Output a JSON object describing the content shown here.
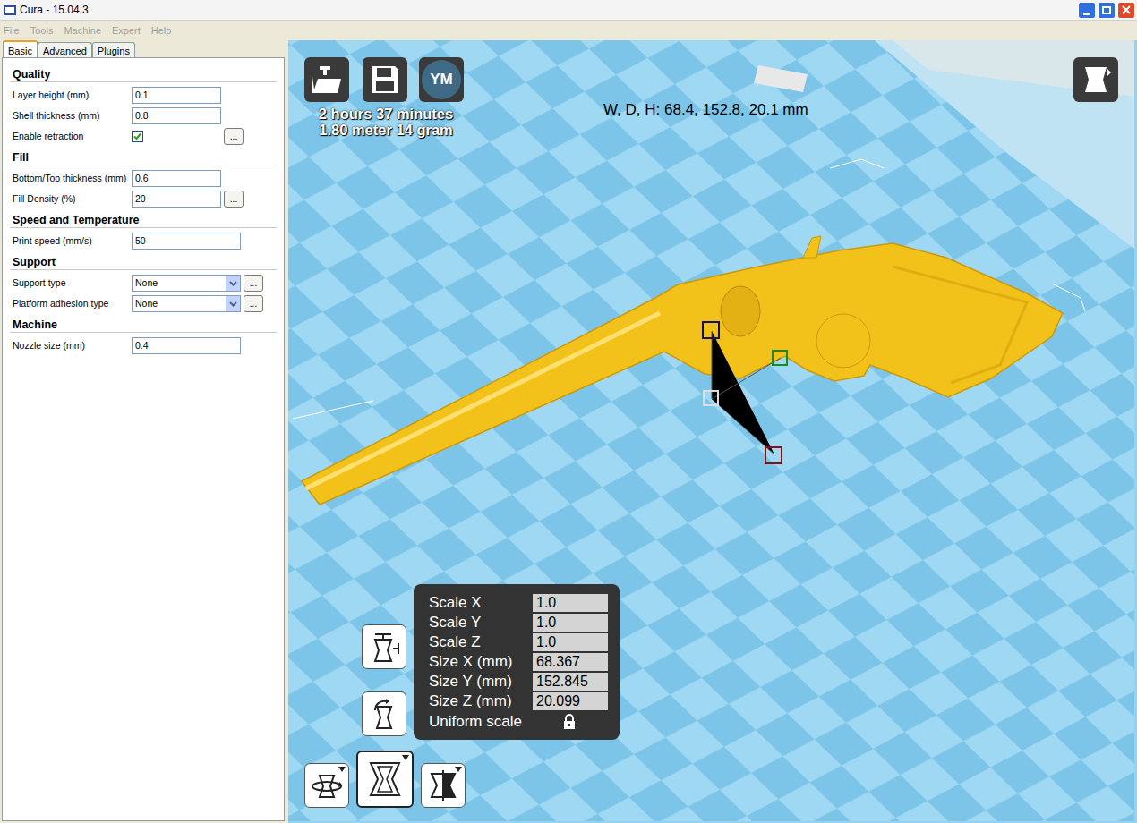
{
  "window": {
    "title": "Cura - 15.04.3"
  },
  "menu": [
    {
      "label": "File",
      "disabled": true
    },
    {
      "label": "Tools",
      "disabled": true
    },
    {
      "label": "Machine",
      "disabled": true
    },
    {
      "label": "Expert",
      "disabled": true
    },
    {
      "label": "Help",
      "disabled": true
    }
  ],
  "tabs": [
    {
      "label": "Basic",
      "selected": true
    },
    {
      "label": "Advanced",
      "selected": false
    },
    {
      "label": "Plugins",
      "selected": false
    }
  ],
  "sections": [
    {
      "title": "Quality",
      "rows": [
        {
          "kind": "input",
          "label": "Layer height (mm)",
          "value": "0.1"
        },
        {
          "kind": "input",
          "label": "Shell thickness (mm)",
          "value": "0.8"
        },
        {
          "kind": "checkbox",
          "label": "Enable retraction",
          "checked": true,
          "button": "..."
        }
      ]
    },
    {
      "title": "Fill",
      "rows": [
        {
          "kind": "input",
          "label": "Bottom/Top thickness (mm)",
          "value": "0.6"
        },
        {
          "kind": "input",
          "label": "Fill Density (%)",
          "value": "20",
          "button": "..."
        }
      ]
    },
    {
      "title": "Speed and Temperature",
      "rows": [
        {
          "kind": "input",
          "label": "Print speed (mm/s)",
          "value": "50"
        }
      ]
    },
    {
      "title": "Support",
      "rows": [
        {
          "kind": "select",
          "label": "Support type",
          "value": "None",
          "button": "..."
        },
        {
          "kind": "select",
          "label": "Platform adhesion type",
          "value": "None",
          "button": "..."
        }
      ]
    },
    {
      "title": "Machine",
      "rows": [
        {
          "kind": "input",
          "label": "Nozzle size (mm)",
          "value": "0.4"
        }
      ]
    }
  ],
  "toolbar": {
    "profile": "YM"
  },
  "estimate": {
    "time": "2 hours 37 minutes",
    "material": "1.80 meter 14 gram"
  },
  "dimensions": "W, D, H: 68.4, 152.8, 20.1 mm",
  "scale_panel": {
    "rows": [
      {
        "label": "Scale X",
        "value": "1.0"
      },
      {
        "label": "Scale Y",
        "value": "1.0"
      },
      {
        "label": "Scale Z",
        "value": "1.0"
      },
      {
        "label": "Size X (mm)",
        "value": "68.367"
      },
      {
        "label": "Size Y (mm)",
        "value": "152.845"
      },
      {
        "label": "Size Z (mm)",
        "value": "20.099"
      }
    ],
    "uniform_label": "Uniform scale",
    "locked": true
  },
  "tools": [
    {
      "kind": "rotate",
      "selected": false
    },
    {
      "kind": "scale",
      "selected": true
    },
    {
      "kind": "mirror",
      "selected": false
    }
  ]
}
